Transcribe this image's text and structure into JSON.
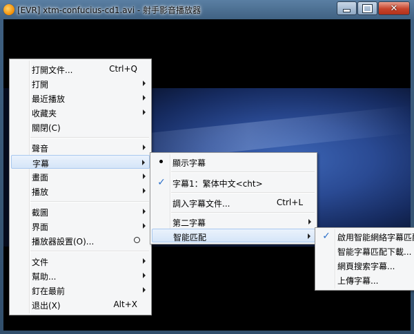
{
  "window": {
    "title": "[EVR] xtm-confucius-cd1.avi - 射手影音播放器",
    "buttons": {
      "minimize": "",
      "maximize": "",
      "close": "✕"
    }
  },
  "main_menu": {
    "items": [
      {
        "label": "打開文件...",
        "shortcut": "Ctrl+Q"
      },
      {
        "label": "打開"
      },
      {
        "label": "最近播放"
      },
      {
        "label": "收藏夹"
      },
      {
        "label": "關閉(C)"
      },
      {
        "label": "聲音"
      },
      {
        "label": "字幕"
      },
      {
        "label": "畫面"
      },
      {
        "label": "播放"
      },
      {
        "label": "截圖"
      },
      {
        "label": "界面"
      },
      {
        "label": "播放器設置(O)..."
      },
      {
        "label": "文件"
      },
      {
        "label": "幫助..."
      },
      {
        "label": "釘在最前"
      },
      {
        "label": "退出(X)",
        "shortcut": "Alt+X"
      }
    ]
  },
  "subtitle_menu": {
    "items": [
      {
        "label": "顯示字幕"
      },
      {
        "label": "字幕1：繁体中文<cht>"
      },
      {
        "label": "調入字幕文件...",
        "shortcut": "Ctrl+L"
      },
      {
        "label": "第二字幕"
      },
      {
        "label": "智能匹配"
      }
    ]
  },
  "match_menu": {
    "items": [
      {
        "label": "啟用智能網絡字幕匹配"
      },
      {
        "label": "智能字幕匹配下載..."
      },
      {
        "label": "網頁搜索字幕..."
      },
      {
        "label": "上傳字幕..."
      }
    ]
  },
  "colors": {
    "highlight": "#d5e5f8",
    "check": "#2a6fc9"
  }
}
